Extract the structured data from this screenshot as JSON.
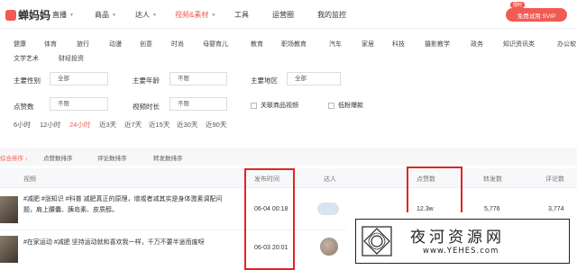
{
  "brand": {
    "name": "蝉妈妈"
  },
  "nav": {
    "items": [
      {
        "label": "直播",
        "has_dropdown": true
      },
      {
        "label": "商品",
        "has_dropdown": true
      },
      {
        "label": "达人",
        "has_dropdown": true
      },
      {
        "label": "视频&素材",
        "has_dropdown": true,
        "active": true
      },
      {
        "label": "工具",
        "has_dropdown": false
      },
      {
        "label": "运营圈",
        "has_dropdown": false
      },
      {
        "label": "我的监控",
        "has_dropdown": false
      }
    ],
    "promo_badge": "限时",
    "trial_button": "免费试用 SVIP"
  },
  "categories": {
    "row1": [
      "健康",
      "体育",
      "旅行",
      "动漫",
      "创意",
      "时尚",
      "母婴育儿",
      "教育",
      "职场教育",
      "汽车",
      "家居",
      "科技",
      "摄影教学",
      "政务",
      "知识资讯类",
      "办公软"
    ],
    "row2": [
      "文学艺术",
      "财经投资"
    ]
  },
  "filters": {
    "gender": {
      "label": "主要性别",
      "value": "全部"
    },
    "age": {
      "label": "主要年龄",
      "value": "不限"
    },
    "region": {
      "label": "主要地区",
      "value": "全部"
    },
    "likes": {
      "label": "点赞数",
      "value": "不限"
    },
    "duration": {
      "label": "视频时长",
      "value": "不限"
    },
    "related_product": {
      "label": "关联商品视频",
      "checked": false
    },
    "low_fans": {
      "label": "低粉爆款",
      "checked": false
    }
  },
  "time_ranges": [
    {
      "label": "6小时",
      "active": false
    },
    {
      "label": "12小时",
      "active": false
    },
    {
      "label": "24小时",
      "active": true
    },
    {
      "label": "近3天",
      "active": false
    },
    {
      "label": "近7天",
      "active": false
    },
    {
      "label": "近15天",
      "active": false
    },
    {
      "label": "近30天",
      "active": false
    },
    {
      "label": "近90天",
      "active": false
    }
  ],
  "sort_tabs": [
    {
      "label": "综合排序",
      "active": true
    },
    {
      "label": "点赞数排序",
      "active": false
    },
    {
      "label": "评论数排序",
      "active": false
    },
    {
      "label": "转发数排序",
      "active": false
    }
  ],
  "table": {
    "headers": {
      "video": "视频",
      "publish_time": "发布时间",
      "creator": "达人",
      "likes": "点赞数",
      "shares": "转发数",
      "comments": "评论数"
    },
    "rows": [
      {
        "title": "#减肥 #涨知识 #科普 减肥真正的原理，增或者减其实是身体激素调配问题，肩上腰囊、胰岛素、皮质醇。",
        "publish_time": "06-04 00:18",
        "likes": "12.3w",
        "shares": "5,776",
        "comments": "3,774"
      },
      {
        "title": "#在家运动 #减肥 坚持运动就和喜欢我一样，千万不要半途而废呀",
        "publish_time": "06-03 20:01",
        "likes": "",
        "shares": "",
        "comments": ""
      }
    ]
  },
  "watermark": {
    "title": "夜河资源网",
    "url": "www.YEHES.com"
  },
  "colors": {
    "accent": "#f25a52",
    "highlight_box": "#e22424"
  }
}
